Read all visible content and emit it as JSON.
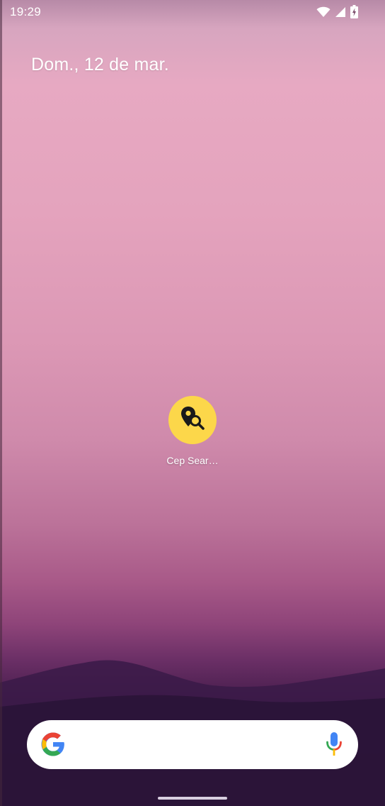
{
  "status_bar": {
    "time": "19:29",
    "icons": [
      "wifi-icon",
      "cell-signal-icon",
      "battery-charging-icon"
    ]
  },
  "home": {
    "date": "Dom., 12 de mar."
  },
  "apps": [
    {
      "label": "Cep Sear…",
      "icon": "map-pin-search-icon",
      "icon_bg": "#fcd74a"
    }
  ],
  "search_widget": {
    "logo": "google-g-icon",
    "mic": "mic-icon"
  },
  "colors": {
    "app_icon_bg": "#fcd74a",
    "search_bg": "#ffffff",
    "google_blue": "#4285f4",
    "google_red": "#ea4335",
    "google_yellow": "#fbbc05",
    "google_green": "#34a853"
  }
}
